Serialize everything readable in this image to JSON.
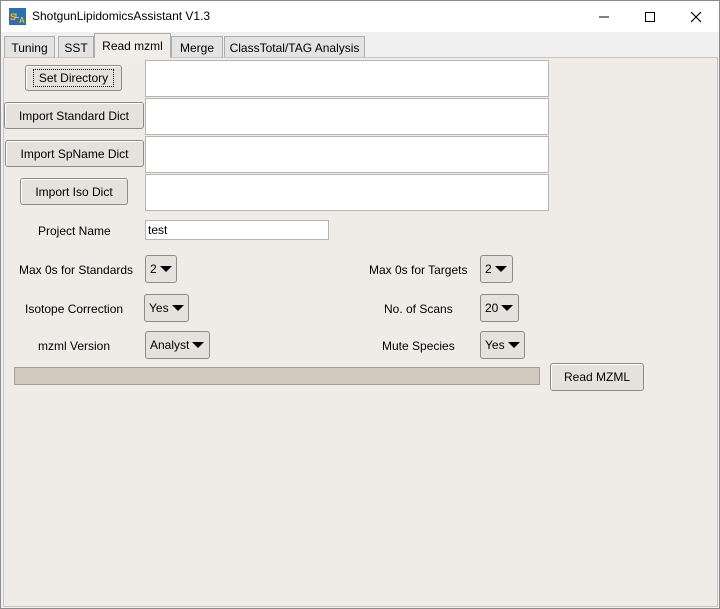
{
  "window": {
    "title": "ShotgunLipidomicsAssistant V1.3",
    "icon": "sla-app-icon"
  },
  "tabs": [
    {
      "label": "Tuning",
      "active": false
    },
    {
      "label": "SST",
      "active": false
    },
    {
      "label": "Read mzml",
      "active": true
    },
    {
      "label": "Merge",
      "active": false
    },
    {
      "label": "ClassTotal/TAG Analysis",
      "active": false
    }
  ],
  "file_rows": {
    "set_directory": {
      "button": "Set Directory",
      "value": ""
    },
    "standard_dict": {
      "button": "Import Standard Dict",
      "value": ""
    },
    "spname_dict": {
      "button": "Import SpName Dict",
      "value": ""
    },
    "iso_dict": {
      "button": "Import Iso Dict",
      "value": ""
    }
  },
  "project": {
    "label": "Project Name",
    "value": "test"
  },
  "options": {
    "max0_standards": {
      "label": "Max 0s for Standards",
      "value": "2"
    },
    "max0_targets": {
      "label": "Max 0s for Targets",
      "value": "2"
    },
    "isotope_correction": {
      "label": "Isotope Correction",
      "value": "Yes"
    },
    "num_scans": {
      "label": "No. of Scans",
      "value": "20"
    },
    "mzml_version": {
      "label": "mzml Version",
      "value": "Analyst"
    },
    "mute_species": {
      "label": "Mute Species",
      "value": "Yes"
    }
  },
  "progress": {
    "fraction": 0
  },
  "actions": {
    "read_mzml": "Read MZML"
  },
  "colors": {
    "accent": "#3d86c6",
    "panel": "#efebe7"
  }
}
